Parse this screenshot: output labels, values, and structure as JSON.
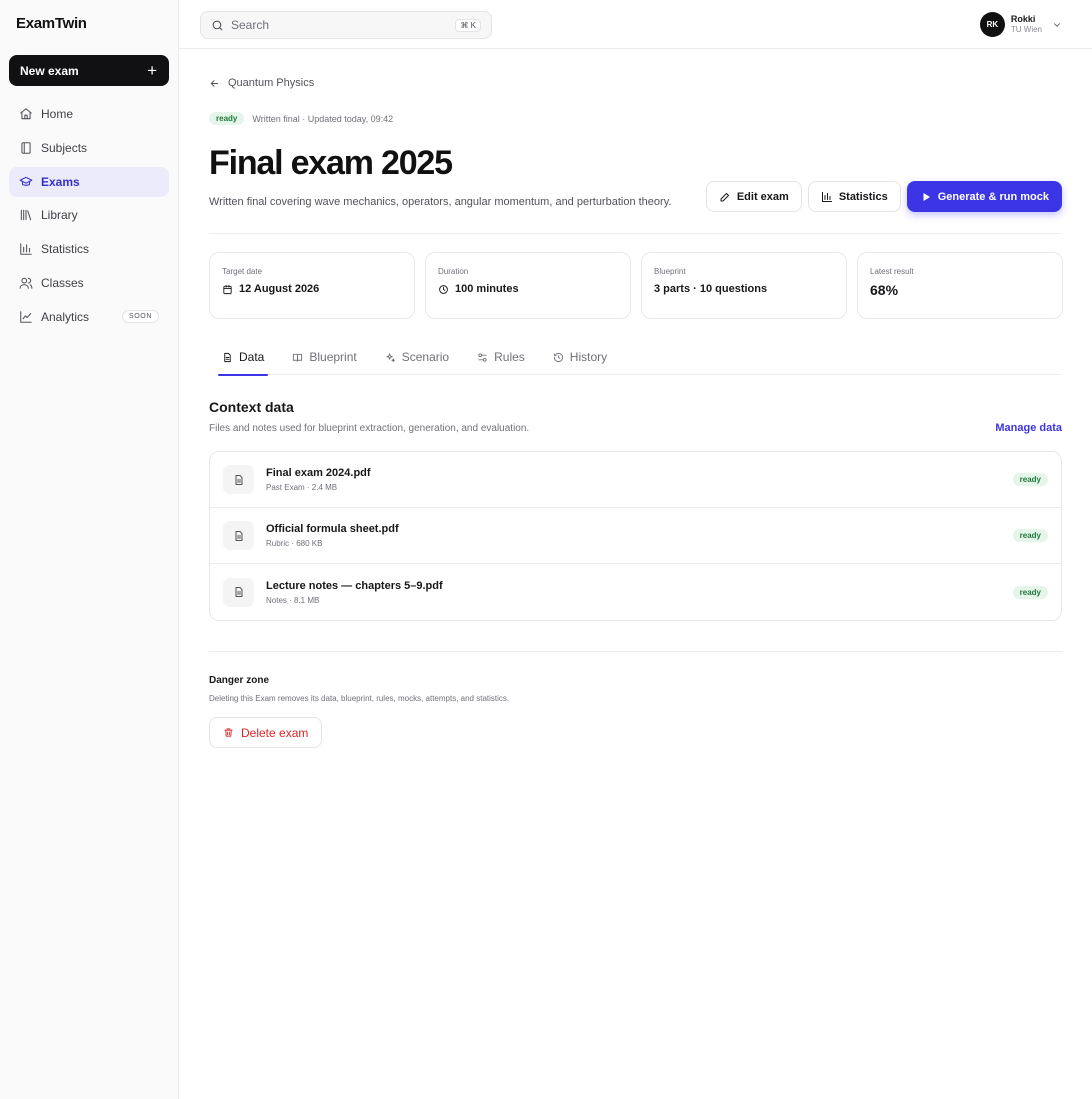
{
  "app": {
    "name": "ExamTwin"
  },
  "sidebar": {
    "new_exam_label": "New exam",
    "items": [
      {
        "label": "Home",
        "icon": "home-icon"
      },
      {
        "label": "Subjects",
        "icon": "book-icon"
      },
      {
        "label": "Exams",
        "icon": "graduation-cap-icon",
        "active": true
      },
      {
        "label": "Library",
        "icon": "library-icon"
      },
      {
        "label": "Statistics",
        "icon": "bar-chart-icon"
      },
      {
        "label": "Classes",
        "icon": "users-icon"
      },
      {
        "label": "Analytics",
        "icon": "trend-chart-icon",
        "badge": "SOON"
      }
    ]
  },
  "topbar": {
    "search_placeholder": "Search",
    "shortcut": "⌘ K",
    "user": {
      "initials": "RK",
      "name": "Rokki",
      "org": "TU Wien"
    }
  },
  "page": {
    "breadcrumb": "Quantum Physics",
    "status": "ready",
    "meta": "Written final · Updated today, 09:42",
    "title": "Final exam 2025",
    "description": "Written final covering wave mechanics, operators, angular momentum, and perturbation theory.",
    "actions": {
      "edit": "Edit exam",
      "statistics": "Statistics",
      "generate": "Generate & run mock"
    },
    "accent_color": "#3c35e6"
  },
  "cards": [
    {
      "label": "Target date",
      "value": "12 August 2026",
      "icon": "calendar-icon"
    },
    {
      "label": "Duration",
      "value": "100 minutes",
      "icon": "clock-icon"
    },
    {
      "label": "Blueprint",
      "value": "3 parts · 10 questions"
    },
    {
      "label": "Latest result",
      "value": "68%"
    }
  ],
  "tabs": [
    {
      "label": "Data",
      "icon": "file-icon",
      "active": true
    },
    {
      "label": "Blueprint",
      "icon": "open-book-icon"
    },
    {
      "label": "Scenario",
      "icon": "sparkles-icon"
    },
    {
      "label": "Rules",
      "icon": "sliders-icon"
    },
    {
      "label": "History",
      "icon": "history-icon"
    }
  ],
  "context": {
    "title": "Context data",
    "subtitle": "Files and notes used for blueprint extraction, generation, and evaluation.",
    "manage_label": "Manage data",
    "files": [
      {
        "name": "Final exam 2024.pdf",
        "meta": "Past Exam · 2.4 MB",
        "status": "ready"
      },
      {
        "name": "Official formula sheet.pdf",
        "meta": "Rubric · 680 KB",
        "status": "ready"
      },
      {
        "name": "Lecture notes — chapters 5–9.pdf",
        "meta": "Notes · 8.1 MB",
        "status": "ready"
      }
    ]
  },
  "danger": {
    "title": "Danger zone",
    "subtitle": "Deleting this Exam removes its data, blueprint, rules, mocks, attempts, and statistics.",
    "delete_label": "Delete exam"
  }
}
